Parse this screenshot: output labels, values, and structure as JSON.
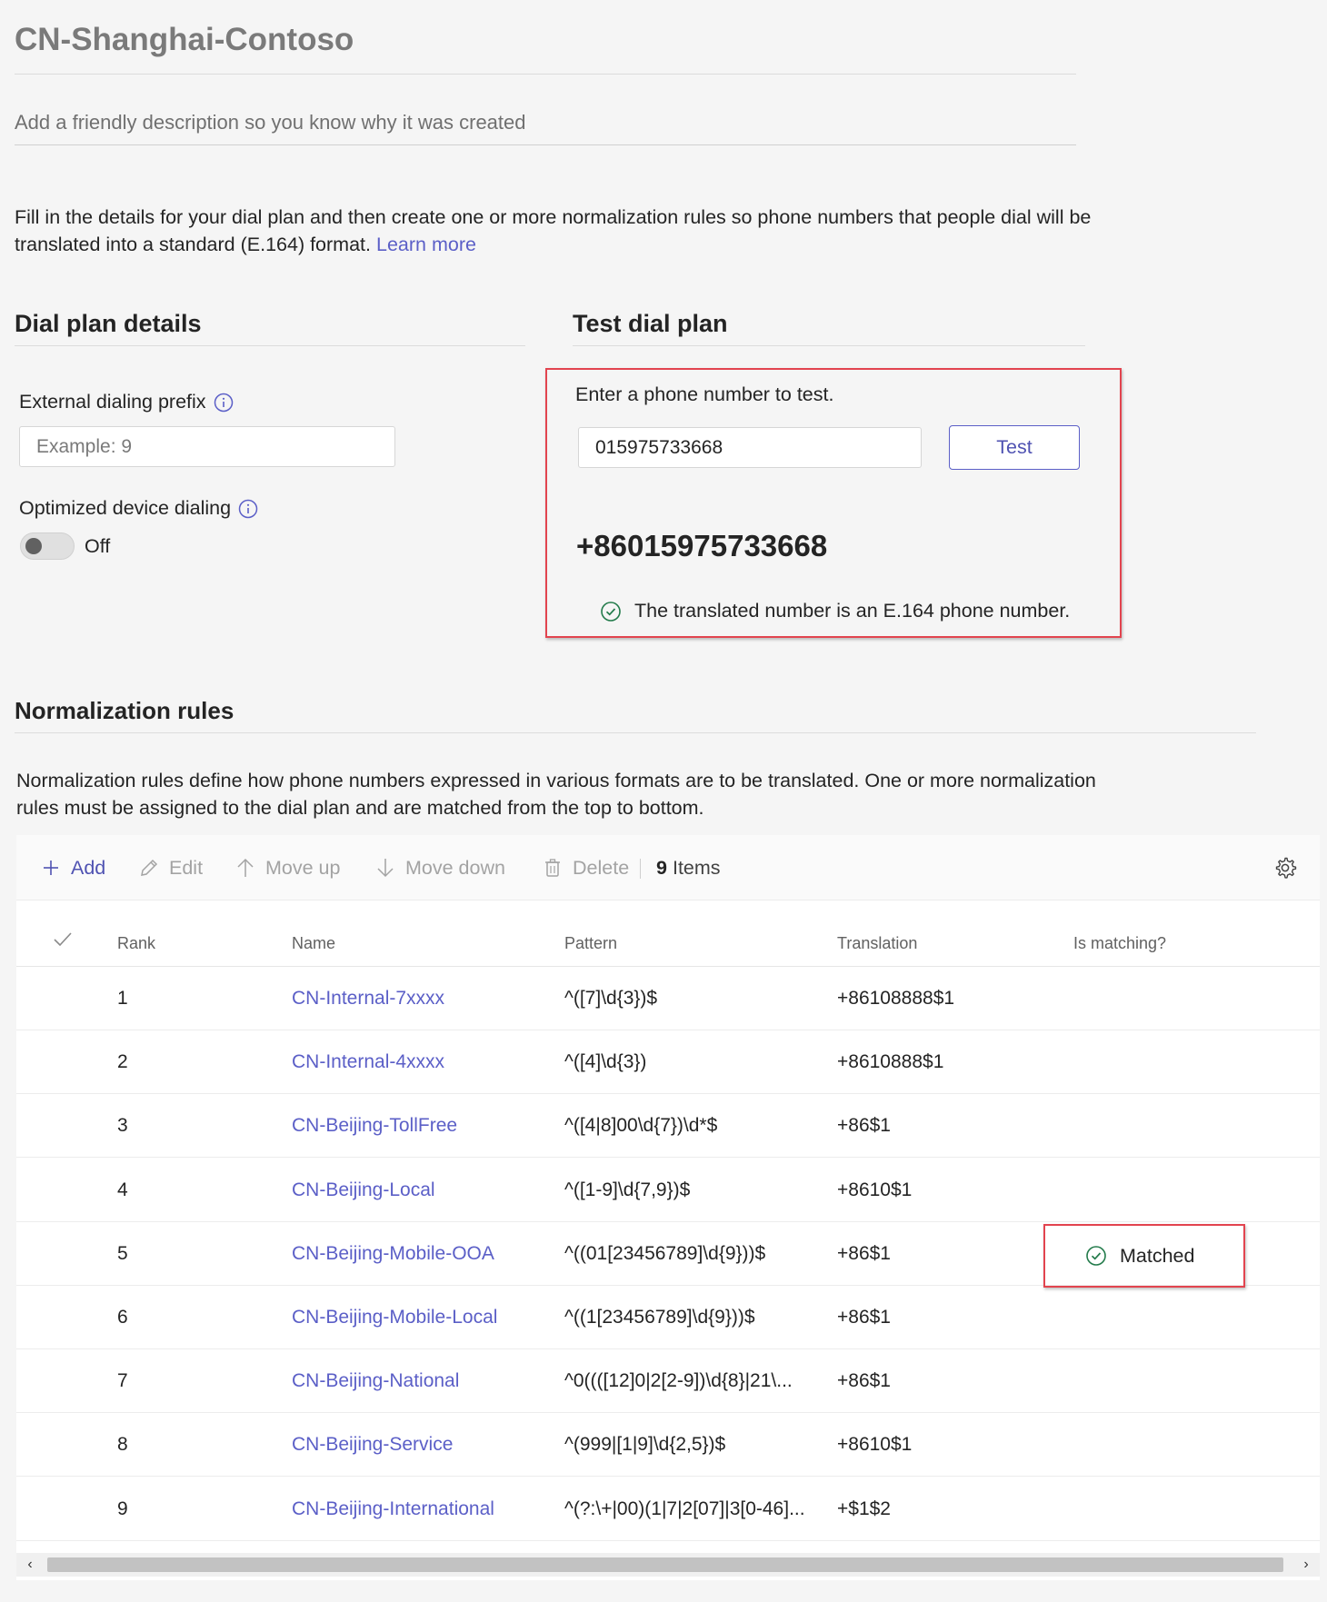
{
  "header": {
    "title": "CN-Shanghai-Contoso",
    "description_placeholder": "Add a friendly description so you know why it was created"
  },
  "intro": {
    "text": "Fill in the details for your dial plan and then create one or more normalization rules so phone numbers that people dial will be translated into a standard (E.164) format.",
    "link": "Learn more"
  },
  "details": {
    "heading": "Dial plan details",
    "prefix_label": "External dialing prefix",
    "prefix_placeholder": "Example: 9",
    "optimized_label": "Optimized device dialing",
    "toggle_state": "Off"
  },
  "test": {
    "heading": "Test dial plan",
    "prompt": "Enter a phone number to test.",
    "input_value": "015975733668",
    "button_label": "Test",
    "result_number": "+86015975733668",
    "result_note": "The translated number is an E.164 phone number."
  },
  "normalization": {
    "heading": "Normalization rules",
    "description": "Normalization rules define how phone numbers expressed in various formats are to be translated. One or more normalization rules must be assigned to the dial plan and are matched from the top to bottom.",
    "toolbar": {
      "add": "Add",
      "edit": "Edit",
      "move_up": "Move up",
      "move_down": "Move down",
      "delete": "Delete",
      "count_number": "9",
      "count_label": "Items"
    },
    "columns": {
      "rank": "Rank",
      "name": "Name",
      "pattern": "Pattern",
      "translation": "Translation",
      "is_matching": "Is matching?"
    },
    "rows": [
      {
        "rank": "1",
        "name": "CN-Internal-7xxxx",
        "pattern": "^([7]\\d{3})$",
        "translation": "+86108888$1"
      },
      {
        "rank": "2",
        "name": "CN-Internal-4xxxx",
        "pattern": "^([4]\\d{3})",
        "translation": "+8610888$1"
      },
      {
        "rank": "3",
        "name": "CN-Beijing-TollFree",
        "pattern": "^([4|8]00\\d{7})\\d*$",
        "translation": "+86$1"
      },
      {
        "rank": "4",
        "name": "CN-Beijing-Local",
        "pattern": "^([1-9]\\d{7,9})$",
        "translation": "+8610$1"
      },
      {
        "rank": "5",
        "name": "CN-Beijing-Mobile-OOA",
        "pattern": "^((01[23456789]\\d{9}))$",
        "translation": "+86$1"
      },
      {
        "rank": "6",
        "name": "CN-Beijing-Mobile-Local",
        "pattern": "^((1[23456789]\\d{9}))$",
        "translation": "+86$1"
      },
      {
        "rank": "7",
        "name": "CN-Beijing-National",
        "pattern": "^0((([12]0|2[2-9])\\d{8}|21\\...",
        "translation": "+86$1"
      },
      {
        "rank": "8",
        "name": "CN-Beijing-Service",
        "pattern": "^(999|[1|9]\\d{2,5})$",
        "translation": "+8610$1"
      },
      {
        "rank": "9",
        "name": "CN-Beijing-International",
        "pattern": "^(?:\\+|00)(1|7|2[07]|3[0-46]...",
        "translation": "+$1$2"
      }
    ],
    "matched_label": "Matched"
  },
  "colors": {
    "accent": "#5b5fc7",
    "highlight_border": "#e2444f",
    "success": "#237b4b"
  }
}
